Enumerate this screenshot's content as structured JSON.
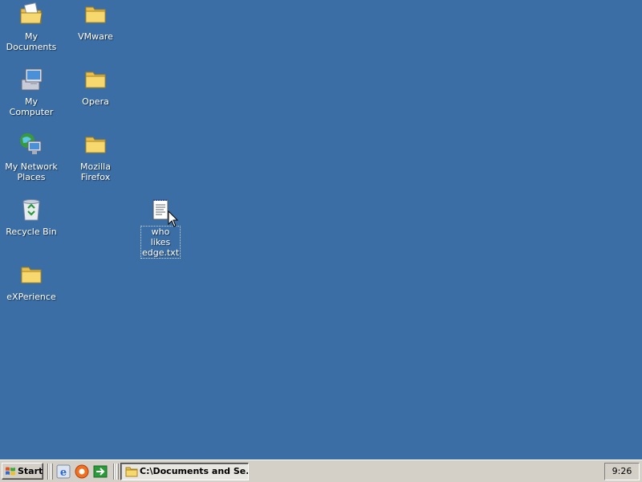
{
  "desktop": {
    "background": "#3a6ea5",
    "icons": [
      {
        "label": "My Documents",
        "icon": "my-documents-icon"
      },
      {
        "label": "VMware",
        "icon": "folder-icon"
      },
      {
        "label": "My Computer",
        "icon": "my-computer-icon"
      },
      {
        "label": "Opera",
        "icon": "folder-icon"
      },
      {
        "label": "My Network Places",
        "icon": "my-network-places-icon"
      },
      {
        "label": "Mozilla Firefox",
        "icon": "folder-icon"
      },
      {
        "label": "Recycle Bin",
        "icon": "recycle-bin-icon"
      },
      {
        "label": "who likes edge.txt",
        "icon": "text-file-icon",
        "selected": true
      },
      {
        "label": "eXPerience",
        "icon": "folder-icon"
      }
    ]
  },
  "taskbar": {
    "start_label": "Start",
    "quick_launch": [
      "internet-explorer-icon",
      "media-player-icon",
      "show-desktop-icon"
    ],
    "tasks": [
      {
        "label": "C:\\Documents and Se...",
        "icon": "folder-icon",
        "active": true
      }
    ],
    "clock": "9:26"
  }
}
